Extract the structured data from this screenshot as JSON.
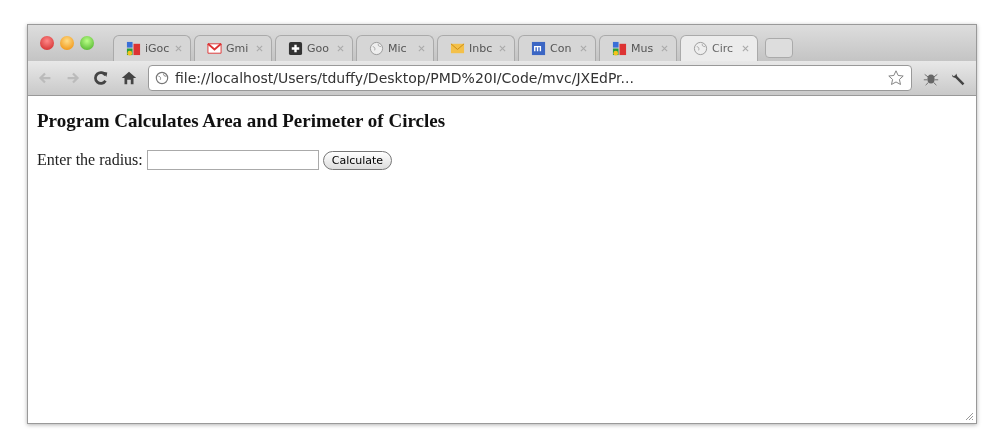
{
  "tabs": [
    {
      "label": "iGoc",
      "kind": "blocks",
      "selected": false
    },
    {
      "label": "Gmi",
      "kind": "mail",
      "selected": false
    },
    {
      "label": "Goo",
      "kind": "plus",
      "selected": false
    },
    {
      "label": "Mic",
      "kind": "globe",
      "selected": false
    },
    {
      "label": "Inbc",
      "kind": "envelope",
      "selected": false
    },
    {
      "label": "Con",
      "kind": "square",
      "selected": false
    },
    {
      "label": "Mus",
      "kind": "blocks",
      "selected": false
    },
    {
      "label": "Circ",
      "kind": "globe",
      "selected": true
    }
  ],
  "address": "file://localhost/Users/tduffy/Desktop/PMD%20I/Code/mvc/JXEdPr...",
  "page": {
    "heading": "Program Calculates Area and Perimeter of Circles",
    "label": "Enter the radius:",
    "button": "Calculate"
  }
}
